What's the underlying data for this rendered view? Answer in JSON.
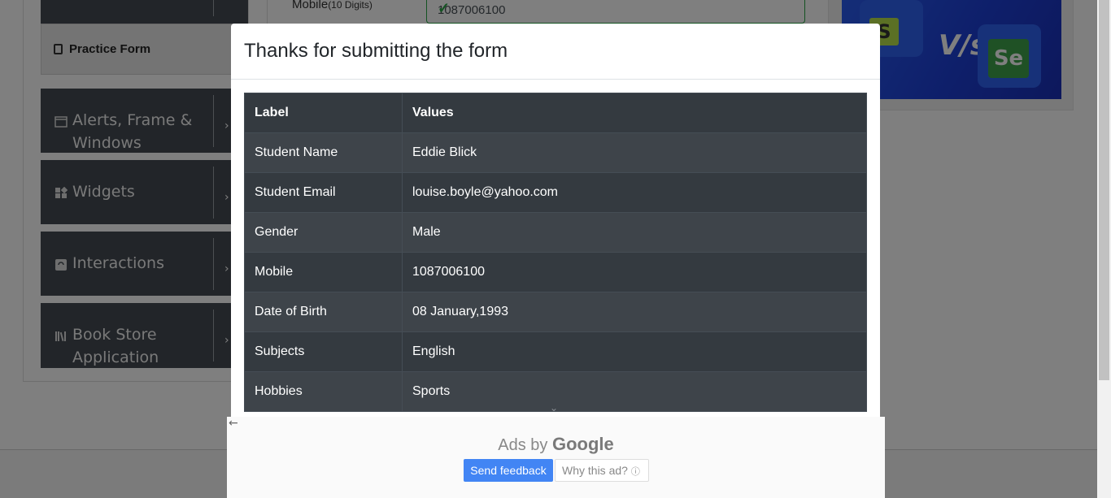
{
  "sidebar": {
    "practice_form": "Practice Form",
    "items": [
      {
        "label": "Alerts, Frame & Windows",
        "icon": "window-icon"
      },
      {
        "label": "Widgets",
        "icon": "widgets-icon"
      },
      {
        "label": "Interactions",
        "icon": "interactions-icon"
      },
      {
        "label": "Book Store Application",
        "icon": "books-icon"
      }
    ]
  },
  "form": {
    "mobile_label": "Mobile",
    "mobile_hint": "(10 Digits)",
    "mobile_value": "1087006100"
  },
  "modal": {
    "title": "Thanks for submitting the form",
    "headers": [
      "Label",
      "Values"
    ],
    "rows": [
      [
        "Student Name",
        "Eddie Blick"
      ],
      [
        "Student Email",
        "louise.boyle@yahoo.com"
      ],
      [
        "Gender",
        "Male"
      ],
      [
        "Mobile",
        "1087006100"
      ],
      [
        "Date of Birth",
        "08 January,1993"
      ],
      [
        "Subjects",
        "English"
      ],
      [
        "Hobbies",
        "Sports"
      ]
    ]
  },
  "ad": {
    "ads_by": "Ads by",
    "google": "Google",
    "send_feedback": "Send feedback",
    "why_this_ad": "Why this ad?",
    "info_glyph": "ⓘ"
  },
  "colors": {
    "table_dark": "#343a40",
    "table_stripe": "#3e444a",
    "valid_green": "#28a745",
    "feedback_blue": "#4285f4"
  }
}
